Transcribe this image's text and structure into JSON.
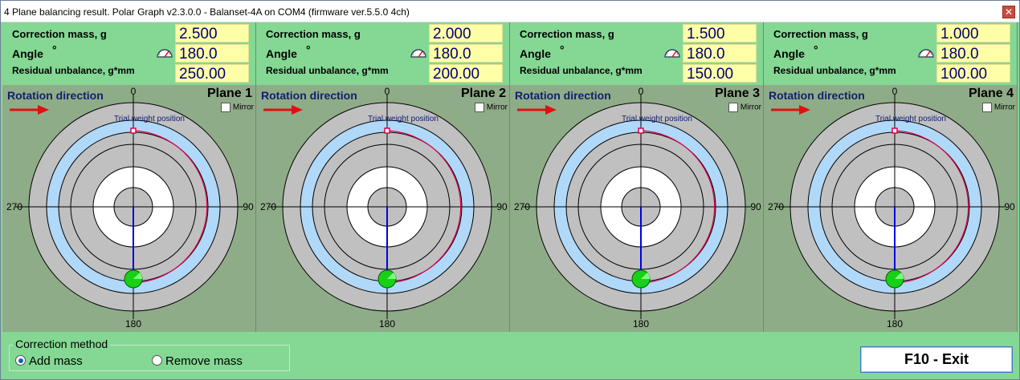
{
  "window": {
    "title": "4 Plane balancing result. Polar Graph v2.3.0.0 - Balanset-4A on COM4 (firmware ver.5.5.0 4ch)",
    "close_glyph": "✕"
  },
  "labels": {
    "correction_mass": "Correction mass, g",
    "angle": "Angle",
    "degree_symbol": "°",
    "residual_unbalance": "Residual unbalance, g*mm",
    "rotation_direction": "Rotation direction",
    "mirror": "Mirror",
    "trial_weight_position": "Trial weight position",
    "tick_0": "0",
    "tick_90": "90",
    "tick_180": "180",
    "tick_270": "270"
  },
  "planes": [
    {
      "name": "Plane 1",
      "correction_mass": "2.500",
      "angle": "180.0",
      "residual_unbalance": "250.00",
      "mirror_checked": false
    },
    {
      "name": "Plane 2",
      "correction_mass": "2.000",
      "angle": "180.0",
      "residual_unbalance": "200.00",
      "mirror_checked": false
    },
    {
      "name": "Plane 3",
      "correction_mass": "1.500",
      "angle": "180.0",
      "residual_unbalance": "150.00",
      "mirror_checked": false
    },
    {
      "name": "Plane 4",
      "correction_mass": "1.000",
      "angle": "180.0",
      "residual_unbalance": "100.00",
      "mirror_checked": false
    }
  ],
  "correction_method": {
    "title": "Correction method",
    "options": [
      "Add mass",
      "Remove mass"
    ],
    "selected": "Add mass"
  },
  "exit_button": "F10 - Exit",
  "icons": {
    "rotation": "red-arrow-right-icon",
    "gauge": "angle-gauge-icon",
    "close": "close-icon"
  },
  "colors": {
    "panel_green": "#84d894",
    "graph_bg": "#8fac88",
    "value_box": "#ffffa8",
    "ring_gray": "#c0c0c0",
    "ring_blue": "#b0d8f8",
    "ring_white": "#ffffff",
    "vector": "#0000e0",
    "marker": "#18d018",
    "trial_arc": "#e0004a",
    "arrow": "#e01010"
  }
}
